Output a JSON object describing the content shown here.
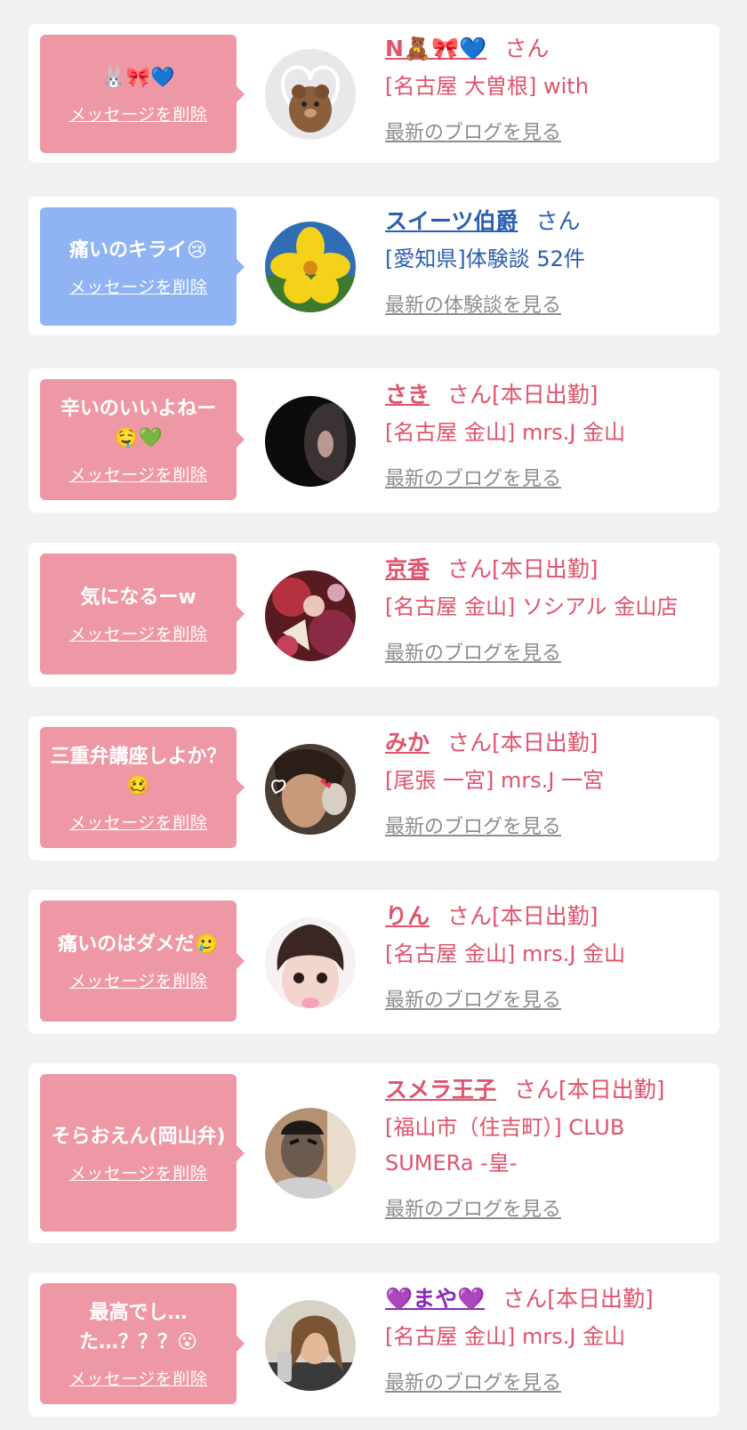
{
  "colors": {
    "pink_text": "#e0536c",
    "blue_text": "#2b5fb0",
    "pink_bubble": "#ef98a5",
    "blue_bubble": "#8fb3f3",
    "link_gray": "#8d8d8d"
  },
  "delete_label": "メッセージを削除",
  "items": [
    {
      "message": "🐰🎀💙",
      "name": "N🧸🎀💙",
      "suffix": "さん",
      "shop": "[名古屋 大曽根] with",
      "link": "最新のブログを見る",
      "theme": "pink",
      "avatar": "bear"
    },
    {
      "message": "痛いのキライ😢",
      "name": "スイーツ伯爵",
      "suffix": "さん",
      "shop": "[愛知県]体験談 52件",
      "link": "最新の体験談を見る",
      "theme": "blue",
      "avatar": "flower"
    },
    {
      "message": "辛いのいいよねー🤤💚",
      "name": "さき",
      "suffix": "さん[本日出勤]",
      "shop": "[名古屋 金山] mrs.J 金山",
      "link": "最新のブログを見る",
      "theme": "pink",
      "avatar": "dark-profile"
    },
    {
      "message": "気になるーw",
      "name": "京香",
      "suffix": "さん[本日出勤]",
      "shop": "[名古屋 金山] ソシアル 金山店",
      "link": "最新のブログを見る",
      "theme": "pink",
      "avatar": "kimono"
    },
    {
      "message": "三重弁講座しよか？🥴",
      "name": "みか",
      "suffix": "さん[本日出勤]",
      "shop": "[尾張 一宮] mrs.J 一宮",
      "link": "最新のブログを見る",
      "theme": "pink",
      "avatar": "cat-filter"
    },
    {
      "message": "痛いのはダメだ🥲",
      "name": "りん",
      "suffix": "さん[本日出勤]",
      "shop": "[名古屋 金山] mrs.J 金山",
      "link": "最新のブログを見る",
      "theme": "pink",
      "avatar": "bangs"
    },
    {
      "message": "そらおえん(岡山弁)",
      "name": "スメラ王子",
      "suffix": "さん[本日出勤]",
      "shop": "[福山市（住吉町）] CLUB SUMERa -皇-",
      "link": "最新のブログを見る",
      "theme": "pink",
      "avatar": "man-face"
    },
    {
      "message": "最高でし…た…？？？😮",
      "name": "💜まや💜",
      "suffix": "さん[本日出勤]",
      "shop": "[名古屋 金山] mrs.J 金山",
      "link": "最新のブログを見る",
      "theme": "pink",
      "avatar": "woman-drink"
    }
  ]
}
